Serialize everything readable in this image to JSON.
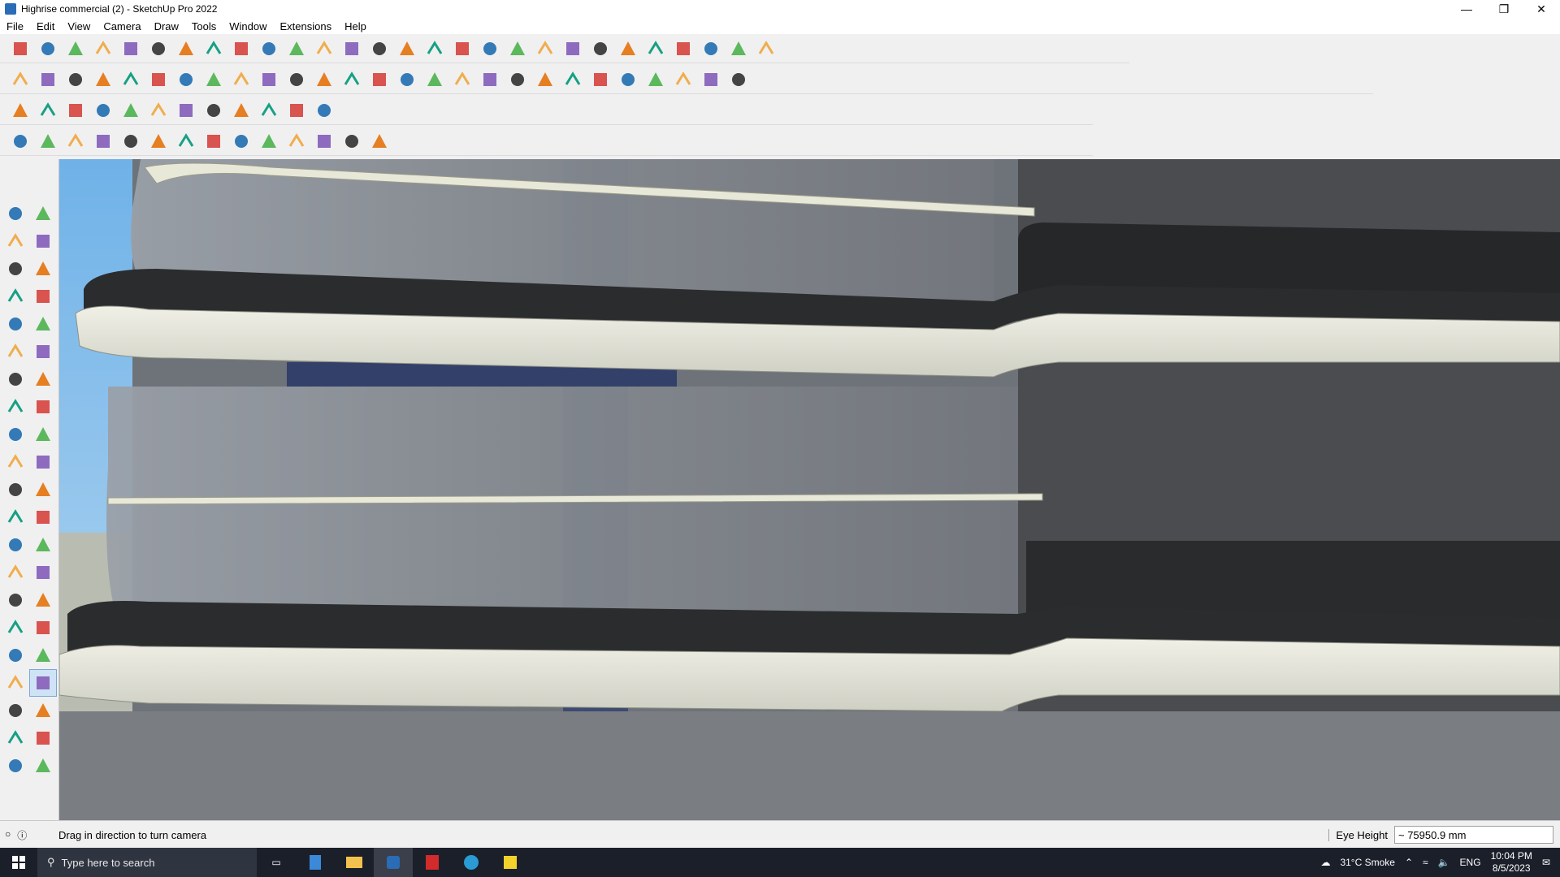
{
  "window": {
    "title": "Highrise commercial (2) - SketchUp Pro 2022",
    "controls": [
      "minimize",
      "restore",
      "close"
    ]
  },
  "menu": [
    "File",
    "Edit",
    "View",
    "Camera",
    "Draw",
    "Tools",
    "Window",
    "Extensions",
    "Help"
  ],
  "toolbars": {
    "row1": [
      "zoom-icon",
      "select-icon",
      "eraser-icon",
      "line-icon",
      "arc-icon",
      "rectangle-icon",
      "push-pull-icon",
      "follow-me-icon",
      "move-icon",
      "rotate-icon",
      "scale-icon",
      "tape-measure-icon",
      "text-icon",
      "paint-bucket-icon",
      "orbit-icon",
      "pan-icon",
      "zoom-icon",
      "zoom-extents-icon",
      "sandbox-icon",
      "layers-icon",
      "styles-icon",
      "outliner-icon",
      "camera-icon",
      "component-icon",
      "section-icon",
      "axis-icon",
      "undo-icon",
      "redo-icon"
    ],
    "row2": [
      "warehouse-icon",
      "component-icon",
      "material-icon",
      "solid-union-icon",
      "solid-subtract-icon",
      "solid-trim-icon",
      "solid-intersect-icon",
      "solid-split-icon",
      "solid-outer-icon",
      "pen-icon",
      "view-iso-icon",
      "view-top-icon",
      "view-front-icon",
      "view-right-icon",
      "view-back-icon",
      "view-left-icon",
      "house-icon",
      "shape-icon",
      "curve-icon",
      "circle-icon",
      "polygon-icon",
      "ellipse-icon",
      "parallelogram-icon",
      "bezier-icon",
      "spline-icon",
      "loft-icon",
      "extrude-icon"
    ],
    "row3": [
      "face-icon",
      "plane-icon",
      "offset-icon",
      "sweep-icon",
      "curve-icon",
      "grid-icon",
      "box-icon",
      "rounded-corner-icon",
      "chamfer-icon",
      "joint-push-pull-icon",
      "fredo-scale-icon",
      "tools-icon"
    ],
    "row4": [
      "draw-icon",
      "bezier-icon",
      "extrude-icon",
      "trim-icon",
      "gear-icon",
      "bend-icon",
      "shell-icon",
      "twist-icon",
      "loft-icon",
      "wall-icon",
      "stair-icon",
      "roof-icon",
      "window-icon",
      "door-icon"
    ]
  },
  "left_tools": [
    {
      "name": "select-icon",
      "active": false
    },
    {
      "name": "orbit-icon",
      "active": false
    },
    {
      "name": "paint-bucket-icon",
      "active": false
    },
    {
      "name": "eraser-icon",
      "active": false
    },
    {
      "name": "make-component-icon",
      "active": false
    },
    {
      "name": "tag-icon",
      "active": false
    },
    {
      "name": "line-icon",
      "active": false
    },
    {
      "name": "freehand-icon",
      "active": false
    },
    {
      "name": "rectangle-icon",
      "active": false
    },
    {
      "name": "rotated-rectangle-icon",
      "active": false
    },
    {
      "name": "circle-icon",
      "active": false
    },
    {
      "name": "polygon-icon",
      "active": false
    },
    {
      "name": "arc-icon",
      "active": false
    },
    {
      "name": "two-point-arc-icon",
      "active": false
    },
    {
      "name": "three-point-arc-icon",
      "active": false
    },
    {
      "name": "pie-icon",
      "active": false
    },
    {
      "name": "move-icon",
      "active": false
    },
    {
      "name": "push-pull-icon",
      "active": false
    },
    {
      "name": "rotate-icon",
      "active": false
    },
    {
      "name": "follow-me-icon",
      "active": false
    },
    {
      "name": "scale-icon",
      "active": false
    },
    {
      "name": "offset-icon",
      "active": false
    },
    {
      "name": "tape-measure-icon",
      "active": false
    },
    {
      "name": "dimension-icon",
      "active": false
    },
    {
      "name": "protractor-icon",
      "active": false
    },
    {
      "name": "text-icon",
      "active": false
    },
    {
      "name": "axes-icon",
      "active": false
    },
    {
      "name": "3d-text-icon",
      "active": false
    },
    {
      "name": "orbit-icon",
      "active": false
    },
    {
      "name": "pan-icon",
      "active": false
    },
    {
      "name": "zoom-icon",
      "active": false
    },
    {
      "name": "zoom-window-icon",
      "active": false
    },
    {
      "name": "zoom-extents-icon",
      "active": false
    },
    {
      "name": "previous-view-icon",
      "active": false
    },
    {
      "name": "position-camera-icon",
      "active": false
    },
    {
      "name": "look-around-icon",
      "active": true
    },
    {
      "name": "walk-icon",
      "active": false
    },
    {
      "name": "section-plane-icon",
      "active": false
    },
    {
      "name": "sandbox-icon",
      "active": false
    },
    {
      "name": "smoove-icon",
      "active": false
    },
    {
      "name": "layers-icon",
      "active": false
    },
    {
      "name": "styles-icon",
      "active": false
    }
  ],
  "status": {
    "hint": "Drag in direction to turn camera",
    "eye_height_label": "Eye Height",
    "eye_height_value": "~ 75950.9 mm"
  },
  "taskbar": {
    "search_placeholder": "Type here to search",
    "apps": [
      "task-view-icon",
      "calculator-icon",
      "file-explorer-icon",
      "sketchup-icon",
      "acrobat-icon",
      "edge-icon",
      "sticky-notes-icon"
    ],
    "weather": "31°C  Smoke",
    "language": "ENG",
    "time": "10:04 PM",
    "date": "8/5/2023"
  },
  "colors": {
    "sky": "#8fb3d9",
    "slab_dark": "#2b2c2e",
    "slab_light": "#e6e6da",
    "glass": "#8e939c",
    "wall_dark": "#3a3b3e"
  }
}
